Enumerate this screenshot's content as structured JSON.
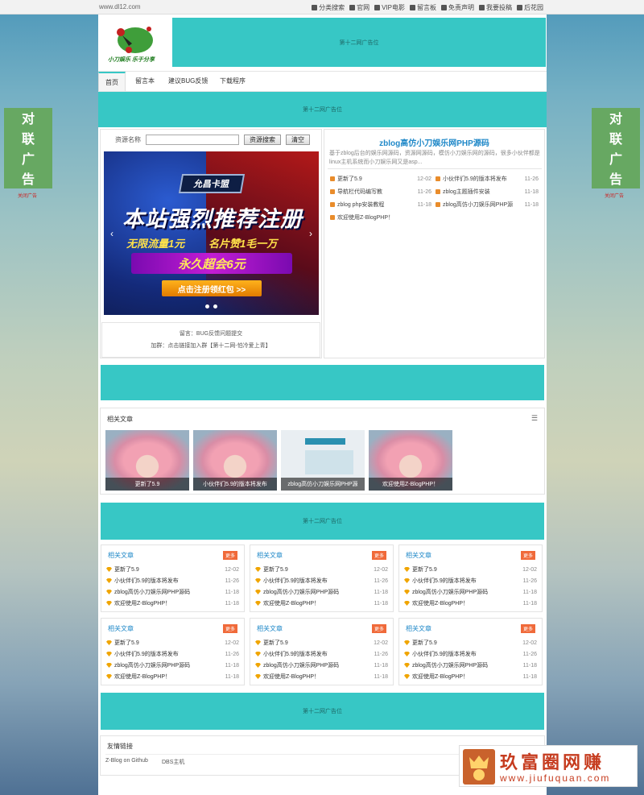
{
  "topbar": {
    "site": "www.dl12.com",
    "links": [
      "分类搜索",
      "官网",
      "VIP电影",
      "留言板",
      "免责声明",
      "我要投稿",
      "后花园"
    ]
  },
  "logo": {
    "text": "小刀娱乐 乐于分享"
  },
  "ads": {
    "header": "第十二网广告位",
    "banner1": "第十二网广告位",
    "banner2": "第十二网广告位",
    "banner3": "第十二网广告位",
    "side_left": "对联广告",
    "side_right": "对联广告",
    "close": "关闭广告"
  },
  "nav": [
    "首页",
    "留言本",
    "建议BUG反馈",
    "下载程序"
  ],
  "search": {
    "label": "资源名称",
    "search_btn": "资源搜索",
    "clear_btn": "清空"
  },
  "slide": {
    "badge": "允昌卡盟",
    "headline": "本站强烈推荐注册",
    "line1a": "无限流量1元",
    "line1b": "名片赞1毛一万",
    "bar": "永久超会6元",
    "cta": "点击注册领红包 >>"
  },
  "notice": {
    "line1": "留言：BUG反馈问题提交",
    "line2": "加群：点击链接加入群【第十二网-怕冷爱上青】"
  },
  "featured": {
    "title": "zblog高仿小刀娱乐网PHP源码",
    "desc": "基于zblog后台的娱乐网源码，资源网源码，模仿小刀娱乐网的源码，很多小伙伴都是linux主机系统而小刀娱乐网又是asp..."
  },
  "latest_left": [
    {
      "title": "更新了5.9",
      "date": "12-02"
    },
    {
      "title": "导航栏代码编写教",
      "date": "11-26"
    },
    {
      "title": "zblog php安装教程",
      "date": "11-18"
    },
    {
      "title": "欢迎使用Z-BlogPHP！",
      "date": "11-18"
    }
  ],
  "latest_right": [
    {
      "title": "小伙伴们5.9的版本将发布",
      "date": "11-26"
    },
    {
      "title": "zblog主题插件安装",
      "date": "11-18"
    },
    {
      "title": "zblog高仿小刀娱乐网PHP源",
      "date": "11-18"
    }
  ],
  "related": {
    "title": "相关文章",
    "items": [
      {
        "caption": "更新了5.9"
      },
      {
        "caption": "小伙伴们5.9的版本将发布"
      },
      {
        "caption": "zblog高仿小刀娱乐网PHP源"
      },
      {
        "caption": "欢迎使用Z-BlogPHP！"
      }
    ]
  },
  "cards": {
    "heading": "相关文章",
    "more": "更多",
    "rows": [
      {
        "title": "更新了5.9",
        "date": "12-02"
      },
      {
        "title": "小伙伴们5.9的版本将发布",
        "date": "11-26"
      },
      {
        "title": "zblog高仿小刀娱乐网PHP源码",
        "date": "11-18"
      },
      {
        "title": "欢迎使用Z-BlogPHP！",
        "date": "11-18"
      }
    ]
  },
  "friends": {
    "title": "友情链接",
    "links": [
      "Z-Blog on Github",
      "DBS主机"
    ]
  },
  "watermark": {
    "title": "玖富圈网赚",
    "url": "www.jiufuquan.com"
  }
}
